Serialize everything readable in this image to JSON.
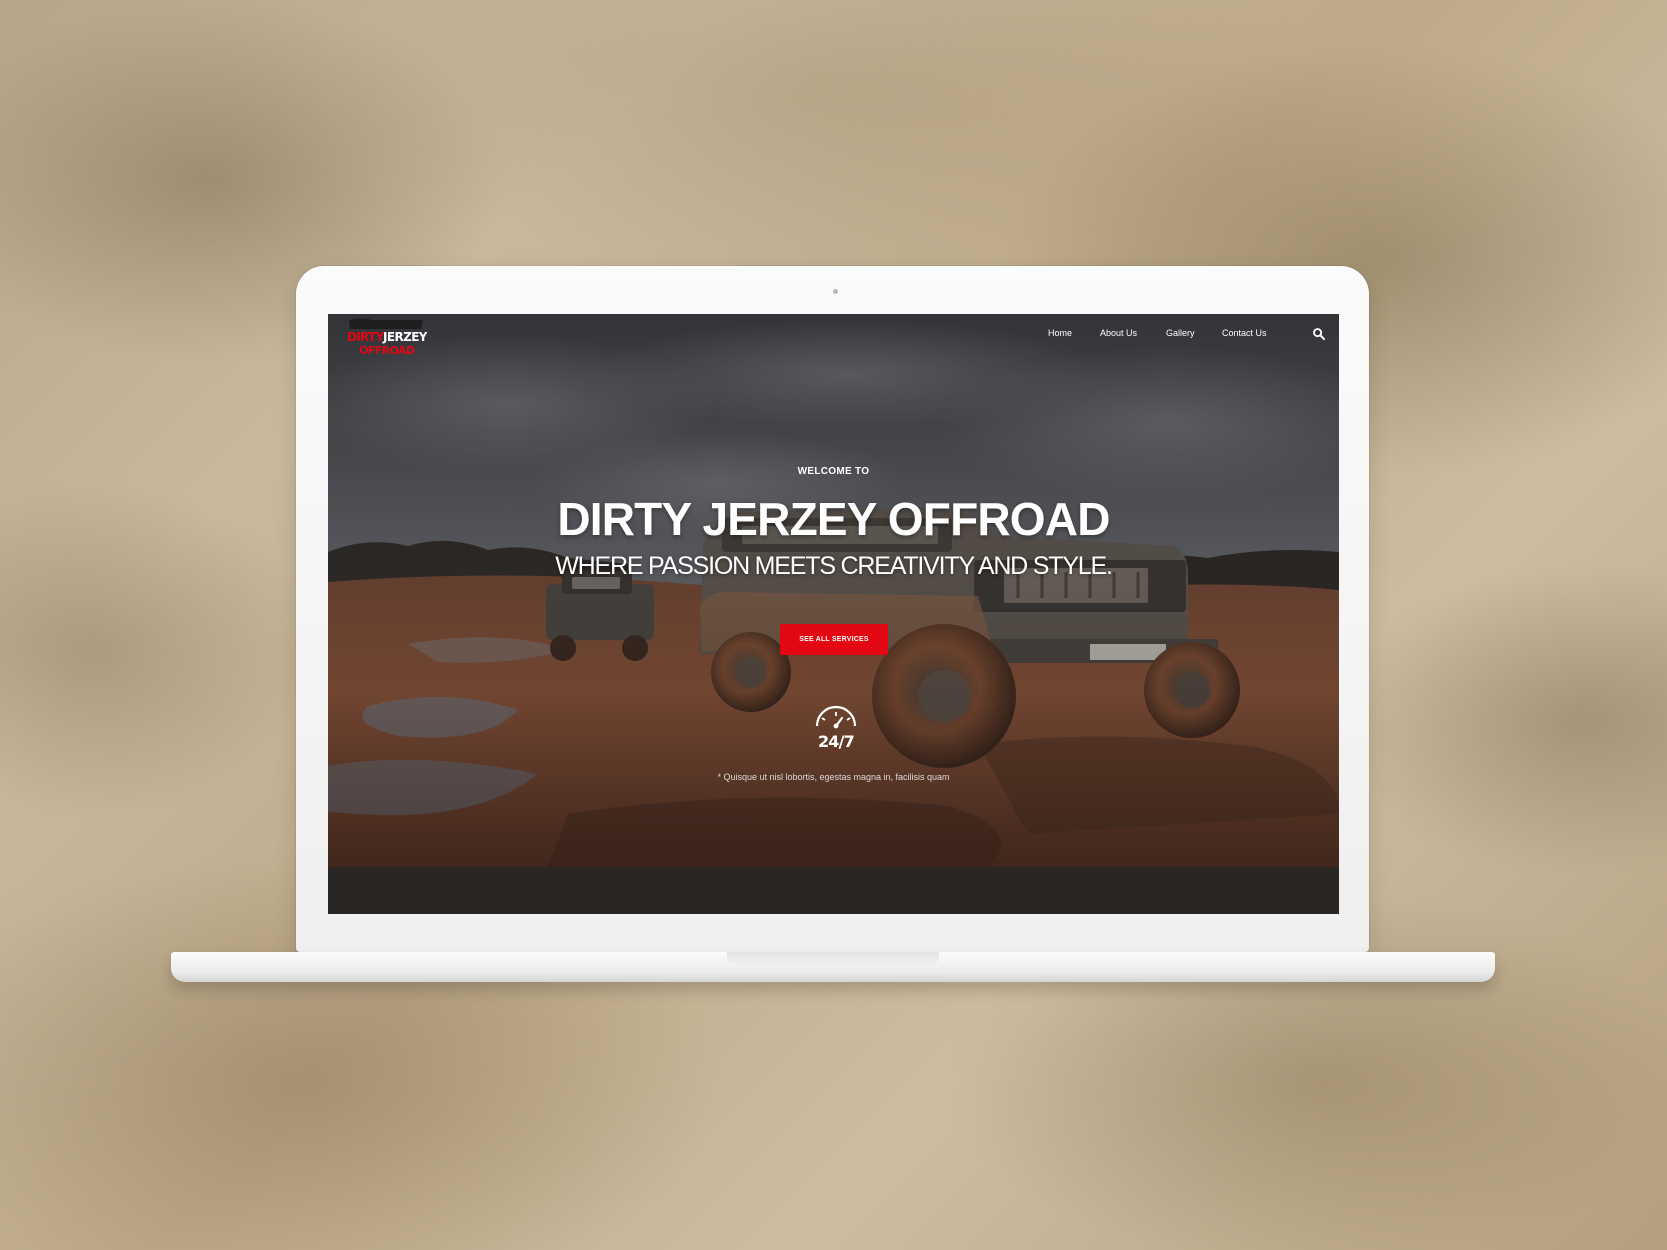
{
  "header": {
    "logo": {
      "line1_red": "DIRTY",
      "line1_white": "JERZEY",
      "line2": "OFFROAD"
    },
    "nav": [
      {
        "label": "Home"
      },
      {
        "label": "About Us"
      },
      {
        "label": "Gallery"
      },
      {
        "label": "Contact Us"
      }
    ],
    "search_icon": "search-icon"
  },
  "hero": {
    "eyebrow": "WELCOME TO",
    "title": "DIRTY JERZEY OFFROAD",
    "subtitle": "WHERE PASSION MEETS CREATIVITY AND STYLE.",
    "button_label": "SEE ALL SERVICES",
    "badge_label": "24/7",
    "badge_icon": "clock-24-7-icon",
    "disclaimer": "* Quisque ut nisl lobortis, egestas magna in, facilisis quam"
  },
  "colors": {
    "accent_red": "#e30613",
    "bottom_bar": "#2a2624",
    "laptop_frame": "#f3f3f3"
  }
}
